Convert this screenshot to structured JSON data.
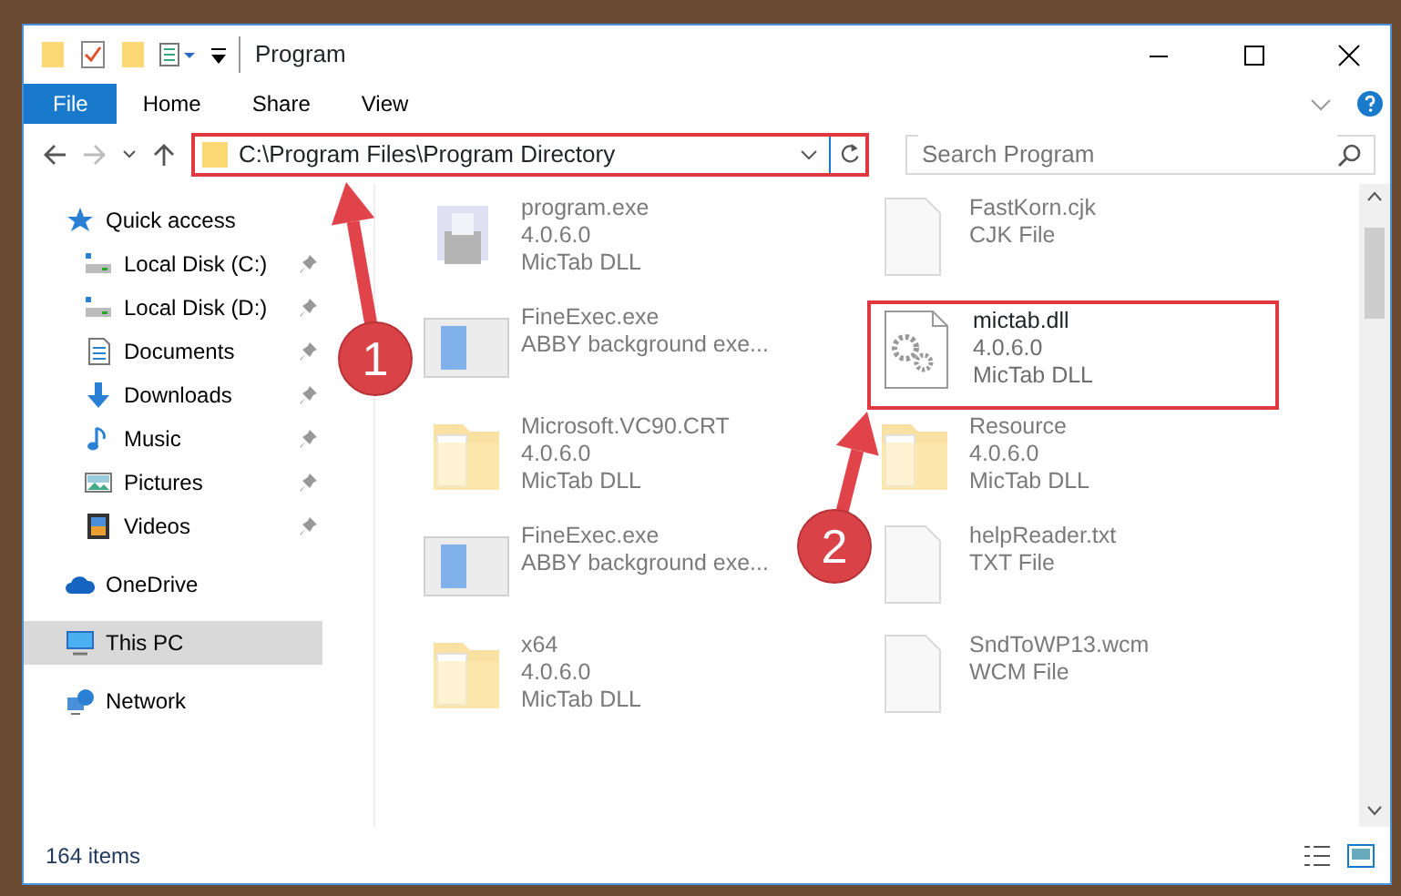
{
  "window": {
    "title": "Program"
  },
  "ribbon": {
    "tabs": [
      {
        "label": "File",
        "kind": "file"
      },
      {
        "label": "Home",
        "kind": "tab"
      },
      {
        "label": "Share",
        "kind": "tab"
      },
      {
        "label": "View",
        "kind": "tab"
      }
    ]
  },
  "address_bar": {
    "path": "C:\\Program Files\\Program Directory"
  },
  "search": {
    "placeholder": "Search Program"
  },
  "sidebar": {
    "items": [
      {
        "label": "Quick access",
        "selected": false,
        "children": [
          {
            "label": "Local Disk (C:)",
            "pinned": true
          },
          {
            "label": "Local Disk (D:)",
            "pinned": true
          },
          {
            "label": "Documents",
            "pinned": true
          },
          {
            "label": "Downloads",
            "pinned": true
          },
          {
            "label": "Music",
            "pinned": true
          },
          {
            "label": "Pictures",
            "pinned": true
          },
          {
            "label": "Videos",
            "pinned": true
          }
        ]
      },
      {
        "label": "OneDrive",
        "selected": false
      },
      {
        "label": "This PC",
        "selected": true
      },
      {
        "label": "Network",
        "selected": false
      }
    ]
  },
  "files": [
    {
      "name": "program.exe",
      "details": [
        "4.0.6.0",
        "MicTab DLL"
      ],
      "kind": "installer",
      "blurred": true
    },
    {
      "name": "FastKorn.cjk",
      "details": [
        "CJK File"
      ],
      "kind": "blank",
      "blurred": true
    },
    {
      "name": "FineExec.exe",
      "details": [
        "ABBY background exe..."
      ],
      "kind": "window",
      "blurred": true
    },
    {
      "name": "mictab.dll",
      "details": [
        "4.0.6.0",
        "MicTab DLL"
      ],
      "kind": "gears",
      "blurred": false
    },
    {
      "name": "Microsoft.VC90.CRT",
      "details": [
        "4.0.6.0",
        "MicTab DLL"
      ],
      "kind": "folder",
      "blurred": true
    },
    {
      "name": "Resource",
      "details": [
        "4.0.6.0",
        "MicTab DLL"
      ],
      "kind": "folder",
      "blurred": true
    },
    {
      "name": "FineExec.exe",
      "details": [
        "ABBY background exe..."
      ],
      "kind": "window",
      "blurred": true
    },
    {
      "name": "helpReader.txt",
      "details": [
        "TXT File"
      ],
      "kind": "blank",
      "blurred": true
    },
    {
      "name": "x64",
      "details": [
        "4.0.6.0",
        "MicTab DLL"
      ],
      "kind": "folder",
      "blurred": true
    },
    {
      "name": "SndToWP13.wcm",
      "details": [
        "WCM File"
      ],
      "kind": "blank",
      "blurred": true
    }
  ],
  "status_bar": {
    "count": "164 items"
  },
  "annotations": [
    {
      "label": "1"
    },
    {
      "label": "2"
    }
  ]
}
